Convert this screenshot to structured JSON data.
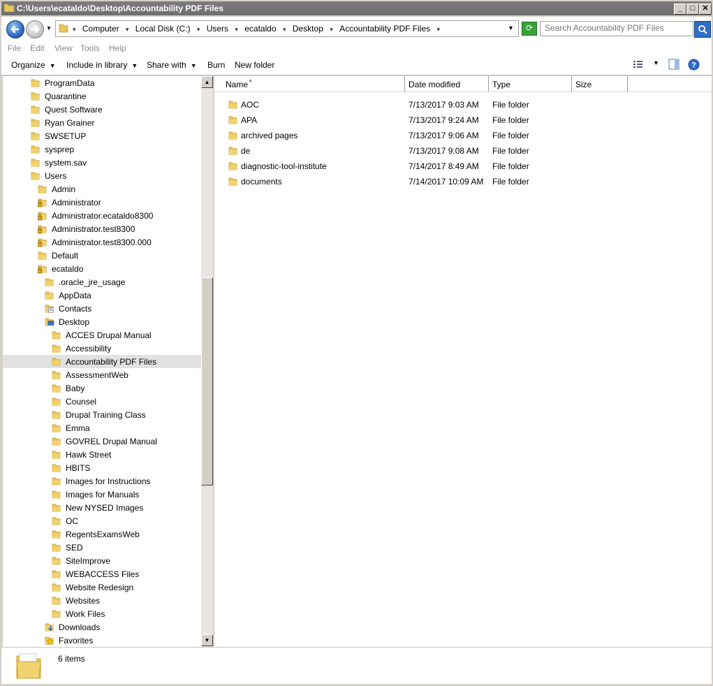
{
  "window": {
    "title": "C:\\Users\\ecataldo\\Desktop\\Accountability PDF Files",
    "minimize_glyph": "_",
    "maximize_glyph": "□",
    "close_glyph": "✕"
  },
  "address": {
    "crumbs": [
      "Computer",
      "Local Disk (C:)",
      "Users",
      "ecataldo",
      "Desktop",
      "Accountability PDF Files"
    ]
  },
  "search": {
    "placeholder": "Search Accountability PDF Files"
  },
  "menu": [
    "File",
    "Edit",
    "View",
    "Tools",
    "Help"
  ],
  "toolbar": {
    "organize": "Organize",
    "include_in_library": "Include in library",
    "share_with": "Share with",
    "burn": "Burn",
    "new_folder": "New folder"
  },
  "nav_tree": [
    {
      "label": "ProgramData",
      "level": 0,
      "icon": "folder"
    },
    {
      "label": "Quarantine",
      "level": 0,
      "icon": "folder"
    },
    {
      "label": "Quest Software",
      "level": 0,
      "icon": "folder"
    },
    {
      "label": "Ryan Grainer",
      "level": 0,
      "icon": "folder"
    },
    {
      "label": "SWSETUP",
      "level": 0,
      "icon": "folder"
    },
    {
      "label": "sysprep",
      "level": 0,
      "icon": "folder"
    },
    {
      "label": "system.sav",
      "level": 0,
      "icon": "folder"
    },
    {
      "label": "Users",
      "level": 0,
      "icon": "folder"
    },
    {
      "label": "Admin",
      "level": 1,
      "icon": "folder"
    },
    {
      "label": "Administrator",
      "level": 1,
      "icon": "locked-folder"
    },
    {
      "label": "Administrator.ecataldo8300",
      "level": 1,
      "icon": "locked-folder"
    },
    {
      "label": "Administrator.test8300",
      "level": 1,
      "icon": "locked-folder"
    },
    {
      "label": "Administrator.test8300.000",
      "level": 1,
      "icon": "locked-folder"
    },
    {
      "label": "Default",
      "level": 1,
      "icon": "folder"
    },
    {
      "label": "ecataldo",
      "level": 1,
      "icon": "locked-folder"
    },
    {
      "label": ".oracle_jre_usage",
      "level": 2,
      "icon": "folder"
    },
    {
      "label": "AppData",
      "level": 2,
      "icon": "folder"
    },
    {
      "label": "Contacts",
      "level": 2,
      "icon": "contacts-folder"
    },
    {
      "label": "Desktop",
      "level": 2,
      "icon": "desktop-folder"
    },
    {
      "label": "ACCES Drupal Manual",
      "level": 3,
      "icon": "folder"
    },
    {
      "label": "Accessibility",
      "level": 3,
      "icon": "folder"
    },
    {
      "label": "Accountability PDF Files",
      "level": 3,
      "icon": "folder",
      "selected": true
    },
    {
      "label": "AssessmentWeb",
      "level": 3,
      "icon": "folder"
    },
    {
      "label": "Baby",
      "level": 3,
      "icon": "folder"
    },
    {
      "label": "Counsel",
      "level": 3,
      "icon": "folder"
    },
    {
      "label": "Drupal Training Class",
      "level": 3,
      "icon": "folder"
    },
    {
      "label": "Emma",
      "level": 3,
      "icon": "folder"
    },
    {
      "label": "GOVREL Drupal Manual",
      "level": 3,
      "icon": "folder"
    },
    {
      "label": "Hawk Street",
      "level": 3,
      "icon": "folder"
    },
    {
      "label": "HBITS",
      "level": 3,
      "icon": "folder"
    },
    {
      "label": "Images for Instructions",
      "level": 3,
      "icon": "folder"
    },
    {
      "label": "Images for Manuals",
      "level": 3,
      "icon": "folder"
    },
    {
      "label": "New NYSED Images",
      "level": 3,
      "icon": "folder"
    },
    {
      "label": "OC",
      "level": 3,
      "icon": "folder"
    },
    {
      "label": "RegentsExamsWeb",
      "level": 3,
      "icon": "folder"
    },
    {
      "label": "SED",
      "level": 3,
      "icon": "folder"
    },
    {
      "label": "SiteImprove",
      "level": 3,
      "icon": "folder"
    },
    {
      "label": "WEBACCESS Files",
      "level": 3,
      "icon": "folder"
    },
    {
      "label": "Website Redesign",
      "level": 3,
      "icon": "folder"
    },
    {
      "label": "Websites",
      "level": 3,
      "icon": "folder"
    },
    {
      "label": "Work Files",
      "level": 3,
      "icon": "folder"
    },
    {
      "label": "Downloads",
      "level": 2,
      "icon": "downloads-folder"
    },
    {
      "label": "Favorites",
      "level": 2,
      "icon": "favorites-folder"
    }
  ],
  "columns": {
    "name": "Name",
    "date": "Date modified",
    "type": "Type",
    "size": "Size"
  },
  "files": [
    {
      "name": "AOC",
      "date": "7/13/2017 9:03 AM",
      "type": "File folder",
      "size": ""
    },
    {
      "name": "APA",
      "date": "7/13/2017 9:24 AM",
      "type": "File folder",
      "size": ""
    },
    {
      "name": "archived pages",
      "date": "7/13/2017 9:06 AM",
      "type": "File folder",
      "size": ""
    },
    {
      "name": "de",
      "date": "7/13/2017 9:08 AM",
      "type": "File folder",
      "size": ""
    },
    {
      "name": "diagnostic-tool-institute",
      "date": "7/14/2017 8:49 AM",
      "type": "File folder",
      "size": ""
    },
    {
      "name": "documents",
      "date": "7/14/2017 10:09 AM",
      "type": "File folder",
      "size": ""
    }
  ],
  "status": {
    "count": "6 items"
  },
  "colors": {
    "folder": "#e8c65a",
    "folder_dark": "#c9a230",
    "selection": "#e1e1e1",
    "accent": "#2f6ec6"
  }
}
